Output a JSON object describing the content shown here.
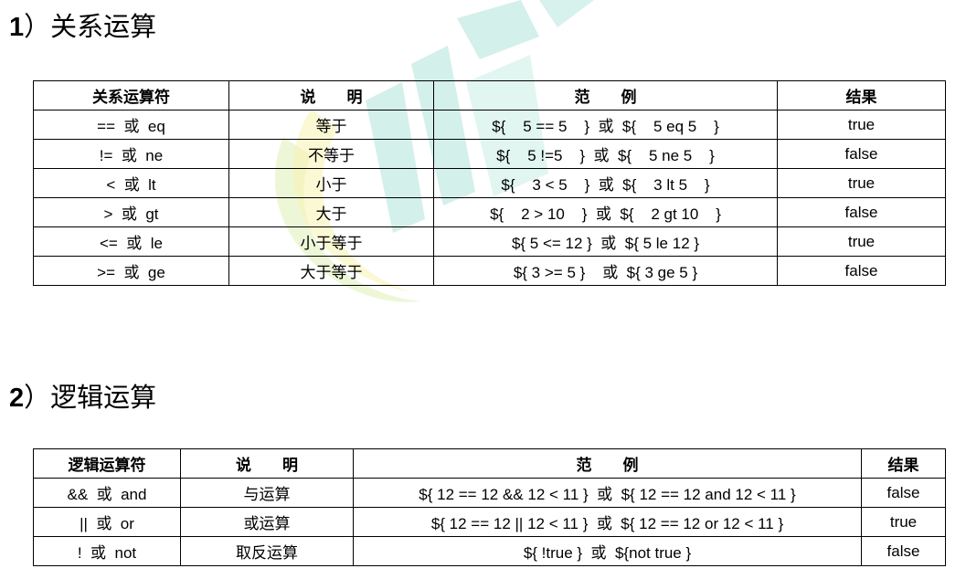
{
  "section1": {
    "title_num": "1",
    "title_text": "）关系运算",
    "headers": [
      "关系运算符",
      "说　　明",
      "范　　例",
      "结果"
    ],
    "rows": [
      {
        "op": "==  或  eq",
        "desc": "等于",
        "example": "${    5 == 5    }  或  ${    5 eq 5    }",
        "result": "true"
      },
      {
        "op": "!=  或  ne",
        "desc": "不等于",
        "example": "${    5 !=5    }  或  ${    5 ne 5    }",
        "result": "false"
      },
      {
        "op": "<  或  lt",
        "desc": "小于",
        "example": "${    3 < 5    }  或  ${    3 lt 5    }",
        "result": "true"
      },
      {
        "op": ">  或  gt",
        "desc": "大于",
        "example": "${    2 > 10    }  或  ${    2 gt 10    }",
        "result": "false"
      },
      {
        "op": "<=  或  le",
        "desc": "小于等于",
        "example": "${ 5 <= 12 }  或  ${ 5 le 12 }",
        "result": "true"
      },
      {
        "op": ">=  或  ge",
        "desc": "大于等于",
        "example": "${ 3 >= 5 }    或  ${ 3 ge 5 }",
        "result": "false"
      }
    ]
  },
  "section2": {
    "title_num": "2",
    "title_text": "）逻辑运算",
    "headers": [
      "逻辑运算符",
      "说　　明",
      "范　　例",
      "结果"
    ],
    "rows": [
      {
        "op": "&&  或  and",
        "desc": "与运算",
        "example": "${ 12 == 12 && 12 < 11 }  或  ${ 12 == 12 and 12 < 11 }",
        "result": "false"
      },
      {
        "op": "||  或  or",
        "desc": "或运算",
        "example": "${ 12 == 12 || 12 < 11 }  或  ${ 12 == 12 or 12 < 11 }",
        "result": "true"
      },
      {
        "op": "!  或  not",
        "desc": "取反运算",
        "example": "${ !true }  或  ${not true }",
        "result": "false"
      }
    ]
  }
}
